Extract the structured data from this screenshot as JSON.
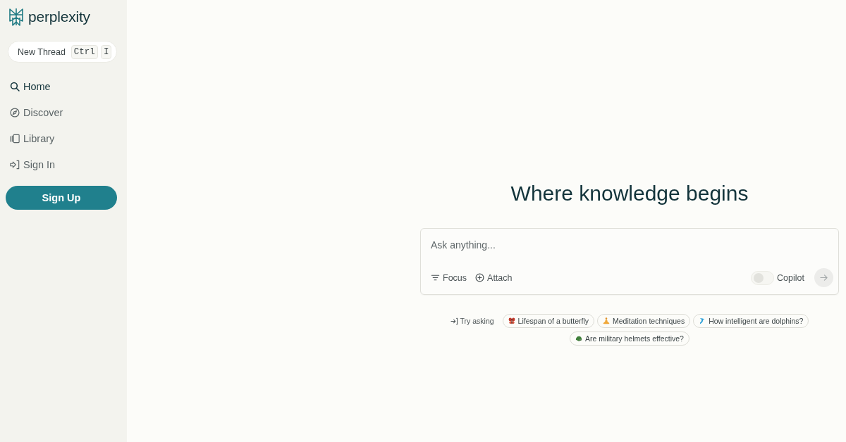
{
  "sidebar": {
    "logo": {
      "text": "perplexity"
    },
    "new_thread": {
      "label": "New Thread",
      "keys": [
        "Ctrl",
        "I"
      ]
    },
    "nav_items": [
      {
        "label": "Home",
        "selected": true
      },
      {
        "label": "Discover",
        "selected": false
      },
      {
        "label": "Library",
        "selected": false
      },
      {
        "label": "Sign In",
        "selected": false
      }
    ],
    "sign_up_button": "Sign Up"
  },
  "main": {
    "heading": "Where knowledge begins",
    "ask_box": {
      "placeholder": "Ask anything...",
      "tools": [
        "Focus",
        "Attach"
      ],
      "copilot": {
        "label": "Copilot",
        "on": false
      },
      "send_disabled": true
    },
    "suggestions": {
      "label": "Try asking",
      "items": [
        "Lifespan of a butterfly",
        "Meditation techniques",
        "How intelligent are dolphins?",
        "Are military helmets effective?"
      ]
    }
  }
}
